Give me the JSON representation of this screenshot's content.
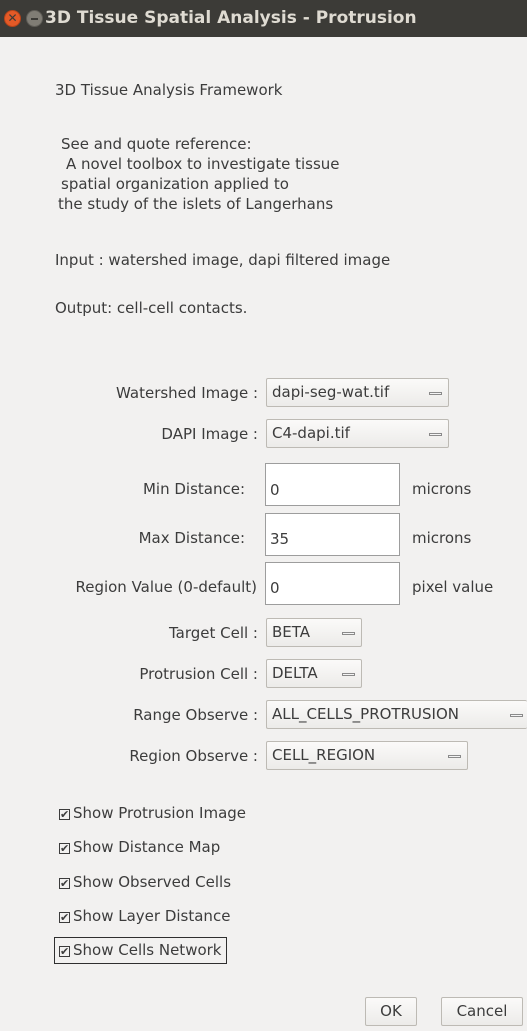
{
  "window": {
    "title": "3D Tissue Spatial Analysis - Protrusion",
    "close_symbol": "✕"
  },
  "header": {
    "framework": "3D Tissue Analysis Framework",
    "reference_lines": [
      "See and quote reference:",
      "A novel toolbox to investigate tissue",
      "spatial organization applied to",
      "the study of the islets of Langerhans"
    ],
    "input": "Input : watershed image, dapi filtered image",
    "output": "Output: cell-cell contacts."
  },
  "form": {
    "watershed": {
      "label": "Watershed Image :",
      "value": "dapi-seg-wat.tif"
    },
    "dapi": {
      "label": "DAPI Image :",
      "value": "C4-dapi.tif"
    },
    "min_distance": {
      "label": "Min Distance:",
      "value": "0",
      "unit": "microns"
    },
    "max_distance": {
      "label": "Max Distance:",
      "value": "35",
      "unit": "microns"
    },
    "region_value": {
      "label": "Region Value (0-default)",
      "value": "0",
      "unit": "pixel value"
    },
    "target_cell": {
      "label": "Target Cell :",
      "value": "BETA"
    },
    "protrusion_cell": {
      "label": "Protrusion Cell :",
      "value": "DELTA"
    },
    "range_observe": {
      "label": "Range Observe :",
      "value": "ALL_CELLS_PROTRUSION"
    },
    "region_observe": {
      "label": "Region Observe :",
      "value": "CELL_REGION"
    }
  },
  "checkboxes": [
    {
      "label": "Show Protrusion Image",
      "checked": true
    },
    {
      "label": "Show Distance Map",
      "checked": true
    },
    {
      "label": "Show Observed Cells",
      "checked": true
    },
    {
      "label": "Show Layer Distance",
      "checked": true
    },
    {
      "label": "Show Cells Network",
      "checked": true
    }
  ],
  "check_mark": "✔",
  "buttons": {
    "ok": "OK",
    "cancel": "Cancel"
  }
}
